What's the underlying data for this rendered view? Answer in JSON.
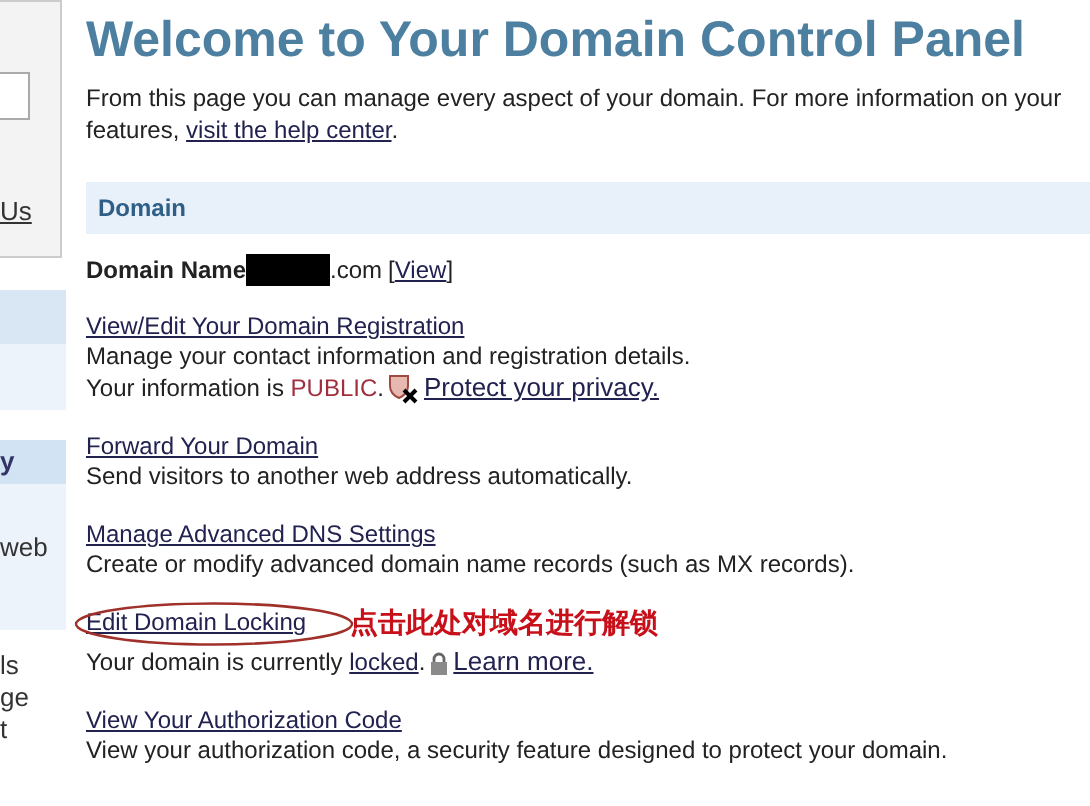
{
  "sidebar": {
    "items": [
      {
        "label": "Us",
        "kind": "link"
      },
      {
        "label": "y",
        "kind": "band"
      },
      {
        "label": "web",
        "kind": "panel"
      },
      {
        "label": "ls",
        "kind": "plain"
      },
      {
        "label": "ge",
        "kind": "plain"
      },
      {
        "label": "t",
        "kind": "plain"
      }
    ]
  },
  "title": "Welcome to Your Domain Control Panel",
  "intro": {
    "line": "From this page you can manage every aspect of your domain. For more information on your",
    "lead": "features, ",
    "link": "visit the help center",
    "tail": "."
  },
  "section_header": "Domain",
  "domain_name": {
    "label": "Domain Name",
    "suffix": ".com",
    "open": "[",
    "link": "View",
    "close": "]"
  },
  "items": [
    {
      "kind": "privacy",
      "link": "View/Edit Your Domain Registration",
      "description": "Manage your contact information and registration details.",
      "status_lead": "Your information is ",
      "status": "PUBLIC",
      "status_tail": ".",
      "action": "Protect your privacy."
    },
    {
      "kind": "plain",
      "link": "Forward Your Domain",
      "description": "Send visitors to another web address automatically."
    },
    {
      "kind": "plain",
      "link": "Manage Advanced DNS Settings",
      "description": "Create or modify advanced domain name records (such as MX records)."
    },
    {
      "kind": "lock",
      "link": "Edit Domain Locking",
      "annotation": "点击此处对域名进行解锁",
      "status_lead": "Your domain is currently ",
      "status": "locked",
      "status_tail": ".",
      "action": "Learn more."
    },
    {
      "kind": "plain",
      "link": "View Your Authorization Code",
      "description": "View your authorization code, a security feature designed to protect your domain."
    }
  ]
}
